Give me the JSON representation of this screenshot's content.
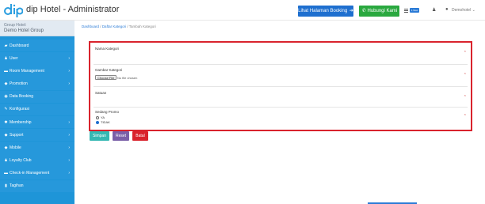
{
  "header": {
    "title": "dip Hotel - Administrator",
    "logo_icon": "dip-logo-icon",
    "booking_button_label": "Lihat Halaman Booking",
    "contact_button_label": "Hubungi Kami",
    "new_badge": "1 New",
    "user_name": "Demohotel",
    "colors": {
      "booking": "#1e6fcf",
      "contact": "#2aa83f"
    }
  },
  "sidebar": {
    "group_line1": "Group Hotel:",
    "group_line2": "Demo Hotel Group",
    "color": "#1e95d8",
    "items": [
      {
        "label": "Dashboard",
        "icon": "dashboard-icon",
        "has_chevron": false
      },
      {
        "label": "User",
        "icon": "user-icon",
        "has_chevron": true
      },
      {
        "label": "Room Management",
        "icon": "room-icon",
        "has_chevron": true
      },
      {
        "label": "Promotion",
        "icon": "tag-icon",
        "has_chevron": true
      },
      {
        "label": "Data Booking",
        "icon": "booking-icon",
        "has_chevron": false
      },
      {
        "label": "Konfigurasi",
        "icon": "wrench-icon",
        "has_chevron": false
      },
      {
        "label": "Membership",
        "icon": "membership-icon",
        "has_chevron": true
      },
      {
        "label": "Support",
        "icon": "support-icon",
        "has_chevron": true
      },
      {
        "label": "Mobile",
        "icon": "mobile-icon",
        "has_chevron": true
      },
      {
        "label": "Loyalty Club",
        "icon": "loyalty-icon",
        "has_chevron": true
      },
      {
        "label": "Check-in Management",
        "icon": "checkin-icon",
        "has_chevron": true
      },
      {
        "label": "Tagihan",
        "icon": "invoice-icon",
        "has_chevron": false
      }
    ]
  },
  "breadcrumb": {
    "items": [
      "Dashboard",
      "Daftar Kategori",
      "Tambah Kategori"
    ],
    "separator": "/"
  },
  "form": {
    "nama_label": "Nama Kategori",
    "gambar_label": "Gambar Kategori",
    "file_button": "Choose File",
    "file_status": "No file chosen",
    "satuan_label": "Satuan",
    "promo_label": "Sedang Promo",
    "promo_options": [
      {
        "label": "YA",
        "checked": false
      },
      {
        "label": "TIDAK",
        "checked": true
      }
    ],
    "required_mark": "×",
    "border_color": "#d9232d"
  },
  "actions": {
    "save_label": "Simpan",
    "reset_label": "Reset",
    "back_label": "Batal"
  }
}
